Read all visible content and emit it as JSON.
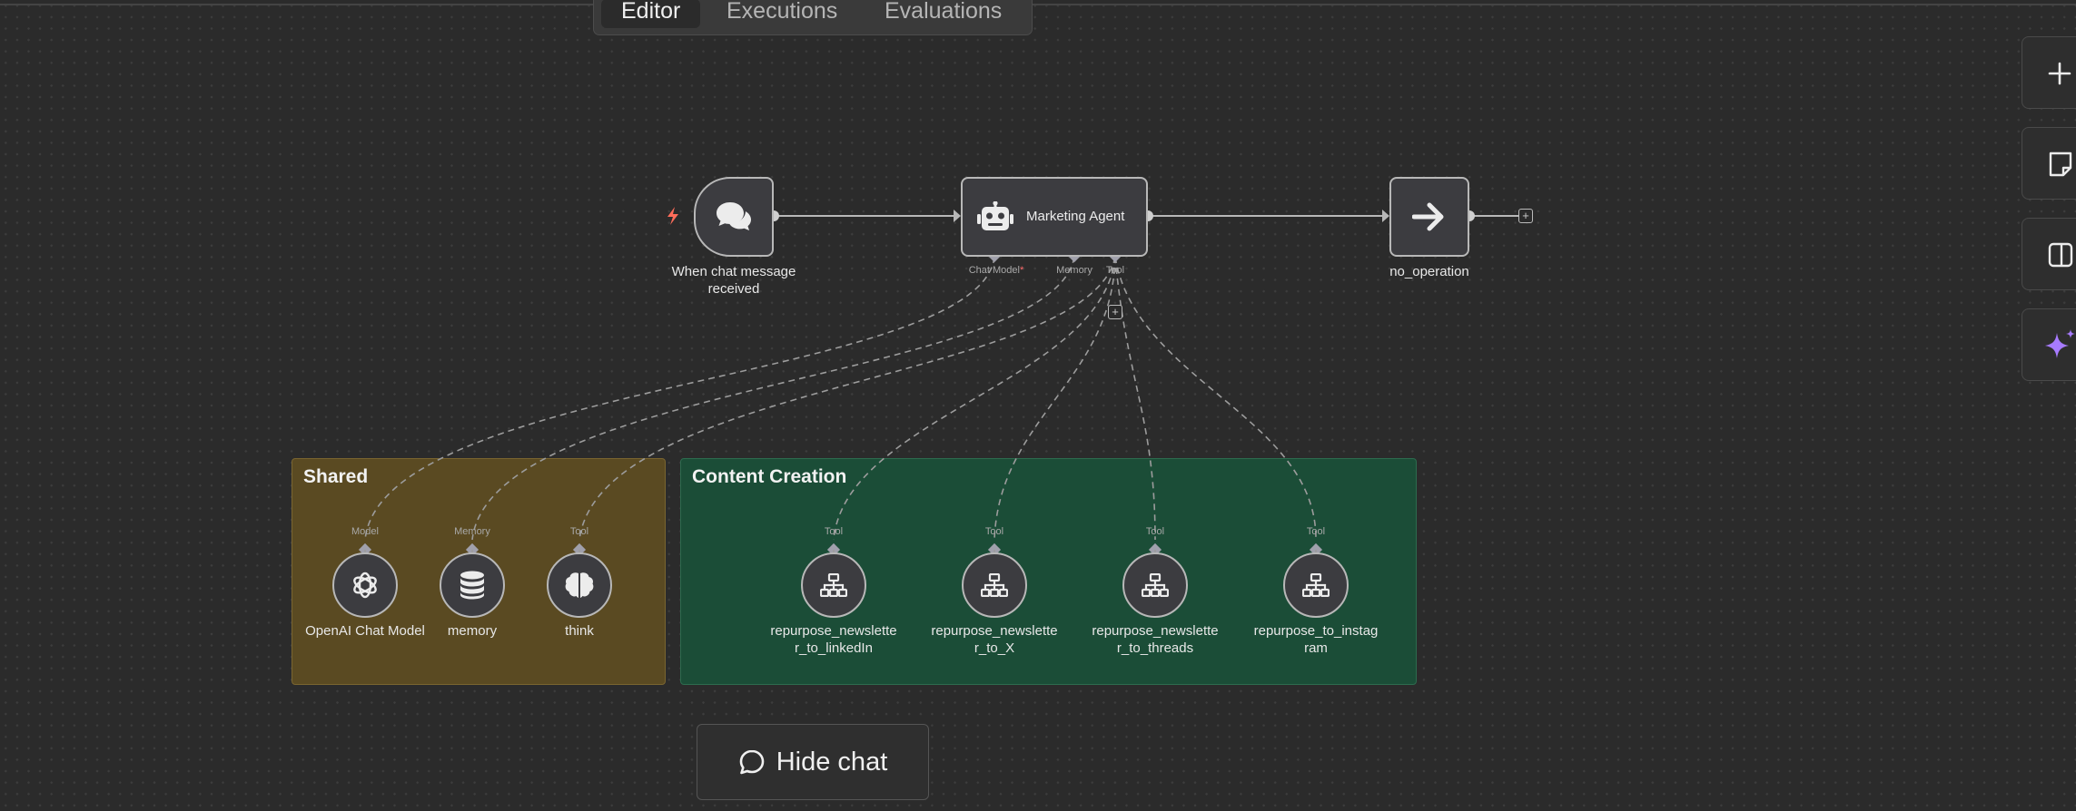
{
  "tabs": [
    {
      "label": "Editor",
      "active": true
    },
    {
      "label": "Executions",
      "active": false
    },
    {
      "label": "Evaluations",
      "active": false
    }
  ],
  "nodes": {
    "trigger": {
      "label": "When chat message received",
      "icon": "chat-bubbles-icon"
    },
    "agent": {
      "label": "Marketing Agent",
      "icon": "robot-icon",
      "ports": {
        "chat_model": "Chat Model",
        "memory": "Memory",
        "tool": "Tool"
      }
    },
    "noop": {
      "label": "no_operation",
      "icon": "arrow-right-icon"
    }
  },
  "groups": {
    "shared": {
      "title": "Shared",
      "color": "#5a4a22",
      "items": [
        {
          "label": "OpenAI Chat Model",
          "port": "Model",
          "icon": "openai-icon"
        },
        {
          "label": "memory",
          "port": "Memory",
          "icon": "database-icon"
        },
        {
          "label": "think",
          "port": "Tool",
          "icon": "brain-icon"
        }
      ]
    },
    "content": {
      "title": "Content Creation",
      "color": "#1b4d37",
      "items": [
        {
          "label": "repurpose_newsletter_to_linkedIn",
          "port": "Tool",
          "icon": "workflow-icon"
        },
        {
          "label": "repurpose_newsletter_to_X",
          "port": "Tool",
          "icon": "workflow-icon"
        },
        {
          "label": "repurpose_newsletter_to_threads",
          "port": "Tool",
          "icon": "workflow-icon"
        },
        {
          "label": "repurpose_to_instagram",
          "port": "Tool",
          "icon": "workflow-icon"
        }
      ]
    }
  },
  "hide_chat": {
    "label": "Hide chat",
    "icon": "chat-icon"
  },
  "side_buttons": [
    "plus-icon",
    "sticky-note-icon",
    "panel-icon",
    "sparkle-icon"
  ],
  "colors": {
    "canvas": "#2b2b2b",
    "accent": "#a77bff",
    "trigger_bolt": "#ff6d5a"
  }
}
